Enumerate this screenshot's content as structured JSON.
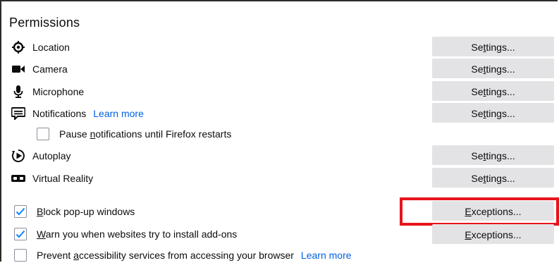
{
  "section": {
    "title": "Permissions"
  },
  "permissions": [
    {
      "label": "Location",
      "icon": "location-target-icon",
      "button": "Settings..."
    },
    {
      "label": "Camera",
      "icon": "camera-icon",
      "button": "Settings..."
    },
    {
      "label": "Microphone",
      "icon": "microphone-icon",
      "button": "Settings..."
    },
    {
      "label": "Notifications",
      "icon": "notification-chat-icon",
      "button": "Settings...",
      "link": "Learn more"
    },
    {
      "label": "Autoplay",
      "icon": "autoplay-icon",
      "button": "Settings..."
    },
    {
      "label": "Virtual Reality",
      "icon": "vr-headset-icon",
      "button": "Settings..."
    }
  ],
  "pause_notifications": {
    "label": "Pause notifications until Firefox restarts",
    "checked": false
  },
  "popups": {
    "label": "Block pop-up windows",
    "checked": true,
    "button": "Exceptions..."
  },
  "addons": {
    "label": "Warn you when websites try to install add-ons",
    "checked": true,
    "button": "Exceptions..."
  },
  "accessibility": {
    "label": "Prevent accessibility services from accessing your browser",
    "checked": false,
    "link": "Learn more"
  },
  "colors": {
    "link": "#0060df",
    "button_bg": "#e3e3e6",
    "highlight": "#e8141c",
    "check": "#0a84ff"
  }
}
